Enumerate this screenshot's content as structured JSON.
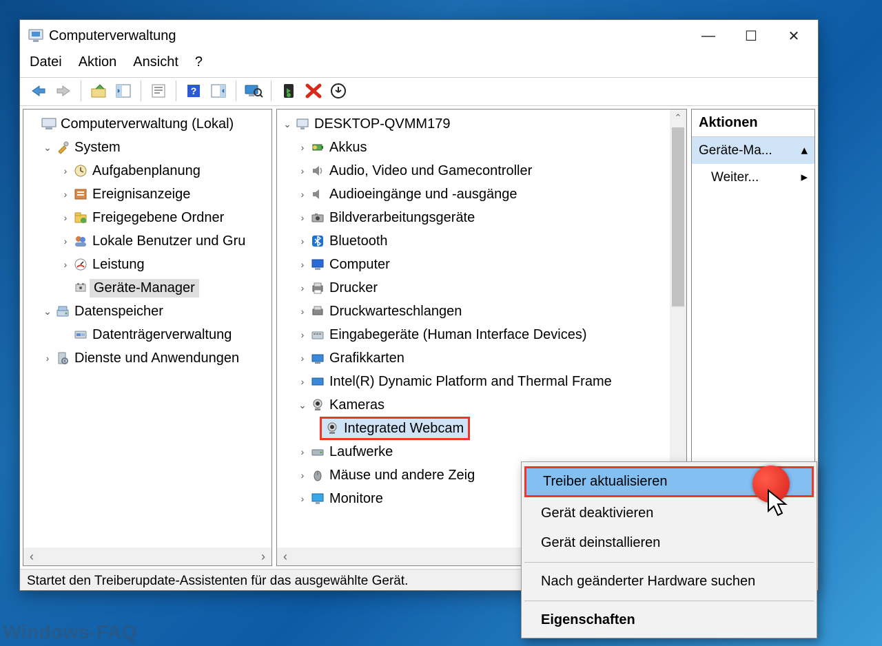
{
  "window": {
    "title": "Computerverwaltung",
    "minimize": "—",
    "maximize": "☐",
    "close": "✕"
  },
  "menubar": [
    "Datei",
    "Aktion",
    "Ansicht",
    "?"
  ],
  "left_tree": {
    "root": "Computerverwaltung (Lokal)",
    "system": "System",
    "system_children": [
      "Aufgabenplanung",
      "Ereignisanzeige",
      "Freigegebene Ordner",
      "Lokale Benutzer und Gru",
      "Leistung",
      "Geräte-Manager"
    ],
    "storage": "Datenspeicher",
    "storage_children": [
      "Datenträgerverwaltung"
    ],
    "services": "Dienste und Anwendungen"
  },
  "center_tree": {
    "root": "DESKTOP-QVMM179",
    "nodes": [
      "Akkus",
      "Audio, Video und Gamecontroller",
      "Audioeingänge und -ausgänge",
      "Bildverarbeitungsgeräte",
      "Bluetooth",
      "Computer",
      "Drucker",
      "Druckwarteschlangen",
      "Eingabegeräte (Human Interface Devices)",
      "Grafikkarten",
      "Intel(R) Dynamic Platform and Thermal Frame"
    ],
    "cameras": "Kameras",
    "webcam": "Integrated Webcam",
    "tail": [
      "Laufwerke",
      "Mäuse und andere Zeig",
      "Monitore"
    ]
  },
  "actions": {
    "header": "Aktionen",
    "item1": "Geräte-Ma...",
    "item2": "Weiter..."
  },
  "context_menu": {
    "update": "Treiber aktualisieren",
    "disable": "Gerät deaktivieren",
    "uninstall": "Gerät deinstallieren",
    "scan": "Nach geänderter Hardware suchen",
    "props": "Eigenschaften"
  },
  "statusbar": "Startet den Treiberupdate-Assistenten für das ausgewählte Gerät.",
  "watermark": "Windows-FAQ"
}
